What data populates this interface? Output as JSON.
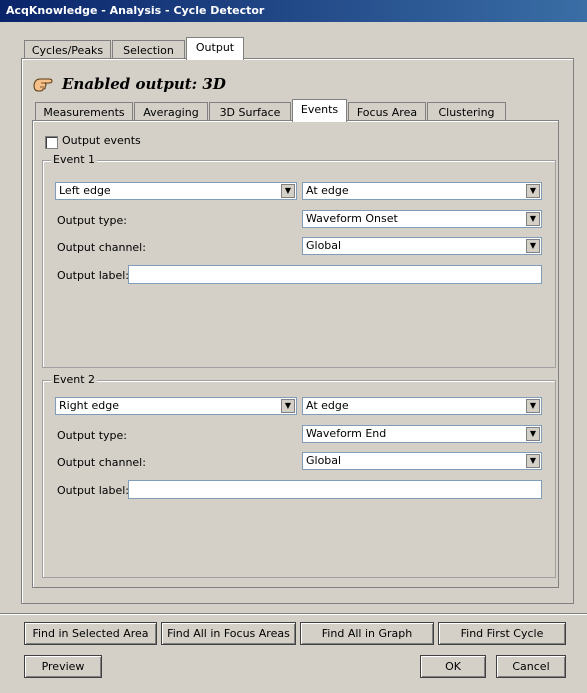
{
  "window": {
    "title": "AcqKnowledge - Analysis - Cycle Detector"
  },
  "main_tabs": [
    {
      "label": "Cycles/Peaks"
    },
    {
      "label": "Selection"
    },
    {
      "label": "Output",
      "active": true
    }
  ],
  "header": {
    "enabled_output": "Enabled output: 3D",
    "icon": "pointing-hand-icon"
  },
  "sub_tabs": [
    {
      "label": "Measurements"
    },
    {
      "label": "Averaging"
    },
    {
      "label": "3D Surface"
    },
    {
      "label": "Events",
      "active": true
    },
    {
      "label": "Focus Area"
    },
    {
      "label": "Clustering"
    }
  ],
  "output_events": {
    "label": "Output events",
    "checked": false
  },
  "event1": {
    "title": "Event 1",
    "edge": "Left edge",
    "position": "At edge",
    "output_type_label": "Output type:",
    "output_type": "Waveform Onset",
    "output_channel_label": "Output channel:",
    "output_channel": "Global",
    "output_label_label": "Output label:",
    "output_label": ""
  },
  "event2": {
    "title": "Event 2",
    "edge": "Right edge",
    "position": "At edge",
    "output_type_label": "Output type:",
    "output_type": "Waveform End",
    "output_channel_label": "Output channel:",
    "output_channel": "Global",
    "output_label_label": "Output label:",
    "output_label": ""
  },
  "find_buttons": {
    "selected_area": "Find in Selected Area",
    "focus_areas": "Find All in Focus Areas",
    "graph": "Find All in Graph",
    "first_cycle": "Find First Cycle"
  },
  "bottom_buttons": {
    "preview": "Preview",
    "ok": "OK",
    "cancel": "Cancel"
  }
}
